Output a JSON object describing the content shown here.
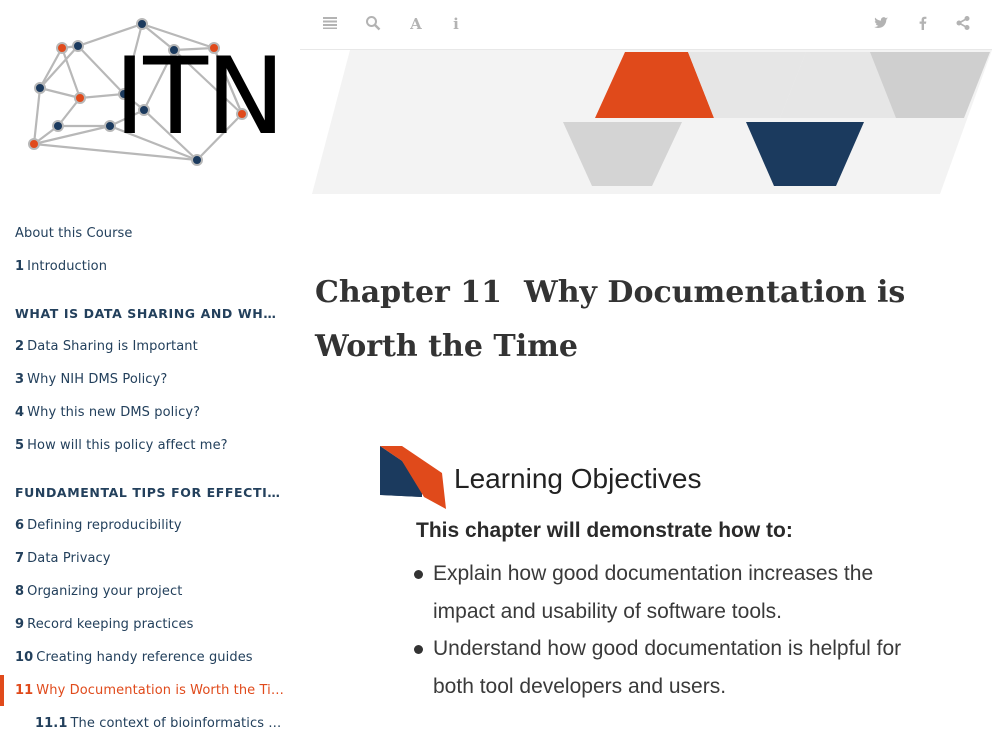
{
  "logo": {
    "text": "ITN"
  },
  "toolbar": {
    "left_icons": [
      "menu-icon",
      "search-icon",
      "font-icon",
      "info-icon"
    ],
    "right_icons": [
      "twitter-icon",
      "facebook-icon",
      "share-icon"
    ]
  },
  "sidebar": {
    "about": "About this Course",
    "intro": {
      "num": "1",
      "label": "Introduction"
    },
    "section1": "WHAT IS DATA SHARING AND WHY IS I...",
    "items_a": [
      {
        "num": "2",
        "label": "Data Sharing is Important"
      },
      {
        "num": "3",
        "label": "Why NIH DMS Policy?"
      },
      {
        "num": "4",
        "label": "Why this new DMS policy?"
      },
      {
        "num": "5",
        "label": "How will this policy affect me?"
      }
    ],
    "section2": "FUNDAMENTAL TIPS FOR EFFECTIVE D...",
    "items_b": [
      {
        "num": "6",
        "label": "Defining reproducibility"
      },
      {
        "num": "7",
        "label": "Data Privacy"
      },
      {
        "num": "8",
        "label": "Organizing your project"
      },
      {
        "num": "9",
        "label": "Record keeping practices"
      },
      {
        "num": "10",
        "label": "Creating handy reference guides"
      }
    ],
    "active": {
      "num": "11",
      "label": "Why Documentation is Worth the Time"
    },
    "sub": {
      "num": "11.1",
      "label": "The context of bioinformatics tool..."
    }
  },
  "main": {
    "chapter_prefix": "Chapter 11",
    "chapter_title": "Why Documentation is Worth the Time",
    "objectives": {
      "heading": "Learning Objectives",
      "subheading": "This chapter will demonstrate how to:",
      "items": [
        "Explain how good documentation increases the impact and usability of software tools.",
        "Understand how good documentation is helpful for both tool developers and users."
      ]
    }
  },
  "colors": {
    "accent": "#e04a1b",
    "navy": "#1b3a5e",
    "gray": "#cccccc",
    "nav_text": "#23405c"
  }
}
